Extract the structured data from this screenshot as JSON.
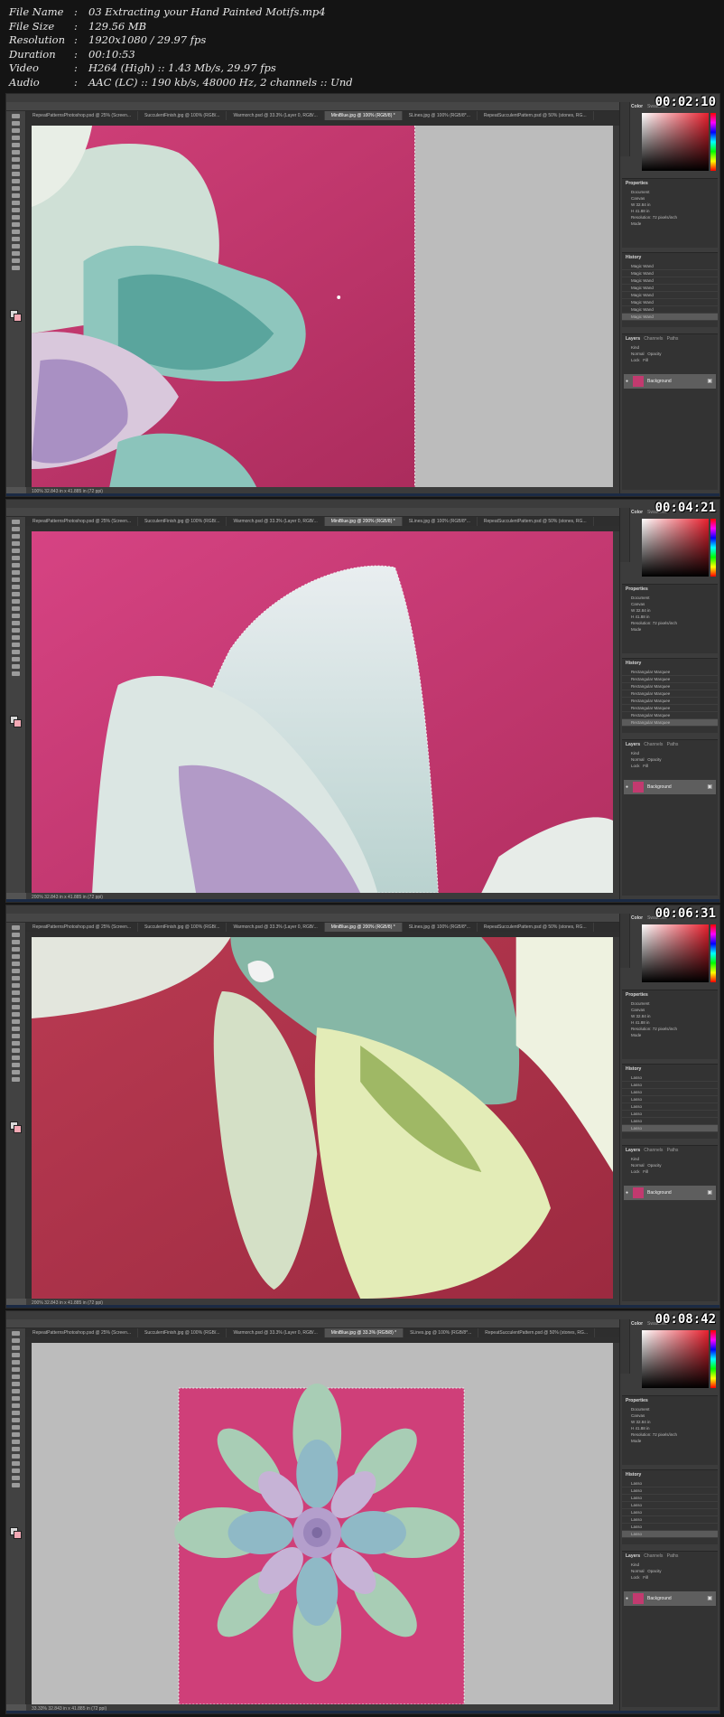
{
  "file_info": [
    {
      "key": "File Name",
      "value": "03 Extracting your Hand Painted Motifs.mp4"
    },
    {
      "key": "File Size",
      "value": "129.56 MB"
    },
    {
      "key": "Resolution",
      "value": "1920x1080 / 29.97 fps"
    },
    {
      "key": "Duration",
      "value": "00:10:53"
    },
    {
      "key": "Video",
      "value": "H264 (High) :: 1.43 Mb/s, 29.97 fps"
    },
    {
      "key": "Audio",
      "value": "AAC (LC) :: 190 kb/s, 48000 Hz, 2 channels :: Und"
    }
  ],
  "separator": ":",
  "panel_labels": {
    "color": "Color",
    "swatches": "Swatches",
    "properties": "Properties",
    "document": "Document",
    "canvas": "Canvas",
    "w": "W",
    "h": "H",
    "w_value": "32.84 in",
    "h_value": "41.88 in",
    "resolution": "Resolution: 72 pixels/inch",
    "mode": "Mode",
    "history": "History",
    "layers": "Layers",
    "channels": "Channels",
    "paths": "Paths",
    "kind": "Kind",
    "normal": "Normal",
    "opacity": "Opacity",
    "lock": "Lock",
    "fill": "Fill",
    "background": "Background"
  },
  "frames": [
    {
      "timestamp": "00:02:10",
      "variant": 1,
      "tabs": [
        "RepeatPatternsPhotoshop.psd @ 25% (Screen...",
        "SucculentFinish.jpg @ 100% (RGB/...",
        "Warmorch.psd @ 33.3% (Layer 0, RGB/...",
        "MiniBlue.jpg @ 100% (RGB/8) *",
        "SLines.jpg @ 100% (RGB/8*...",
        "RepeatSucculentPattern.psd @ 50% (stones, RG..."
      ],
      "active_tab": 3,
      "history": [
        "Magic Wand",
        "Magic Wand",
        "Magic Wand",
        "Magic Wand",
        "Magic Wand",
        "Magic Wand",
        "Magic Wand",
        "Magic Wand"
      ],
      "status": "100%     32.843 in x 41.885 in (72 ppi)"
    },
    {
      "timestamp": "00:04:21",
      "variant": 2,
      "tabs": [
        "RepeatPatternsPhotoshop.psd @ 25% (Screen...",
        "SucculentFinish.jpg @ 100% (RGB/...",
        "Warmorch.psd @ 33.3% (Layer 0, RGB/...",
        "MiniBlue.jpg @ 200% (RGB/8) *",
        "SLines.jpg @ 100% (RGB/8*...",
        "RepeatSucculentPattern.psd @ 50% (stones, RG..."
      ],
      "active_tab": 3,
      "history": [
        "Rectangular Marquee",
        "Rectangular Marquee",
        "Rectangular Marquee",
        "Rectangular Marquee",
        "Rectangular Marquee",
        "Rectangular Marquee",
        "Rectangular Marquee",
        "Rectangular Marquee"
      ],
      "status": "200%     32.843 in x 41.885 in (72 ppi)"
    },
    {
      "timestamp": "00:06:31",
      "variant": 3,
      "tabs": [
        "RepeatPatternsPhotoshop.psd @ 25% (Screen...",
        "SucculentFinish.jpg @ 100% (RGB/...",
        "Warmorch.psd @ 33.3% (Layer 0, RGB/...",
        "MiniBlue.jpg @ 200% (RGB/8) *",
        "SLines.jpg @ 100% (RGB/8*...",
        "RepeatSucculentPattern.psd @ 50% (stones, RG..."
      ],
      "active_tab": 3,
      "history": [
        "Lasso",
        "Lasso",
        "Lasso",
        "Lasso",
        "Lasso",
        "Lasso",
        "Lasso",
        "Lasso"
      ],
      "status": "200%     32.843 in x 41.885 in (72 ppi)"
    },
    {
      "timestamp": "00:08:42",
      "variant": 4,
      "tabs": [
        "RepeatPatternsPhotoshop.psd @ 25% (Screen...",
        "SucculentFinish.jpg @ 100% (RGB/...",
        "Warmorch.psd @ 33.3% (Layer 0, RGB/...",
        "MiniBlue.jpg @ 33.3% (RGB/8) *",
        "SLines.jpg @ 100% (RGB/8*...",
        "RepeatSucculentPattern.psd @ 50% (stones, RG..."
      ],
      "active_tab": 3,
      "history": [
        "Lasso",
        "Lasso",
        "Lasso",
        "Lasso",
        "Lasso",
        "Lasso",
        "Lasso",
        "Lasso"
      ],
      "status": "33.33%     32.843 in x 41.885 in (72 ppi)"
    }
  ]
}
